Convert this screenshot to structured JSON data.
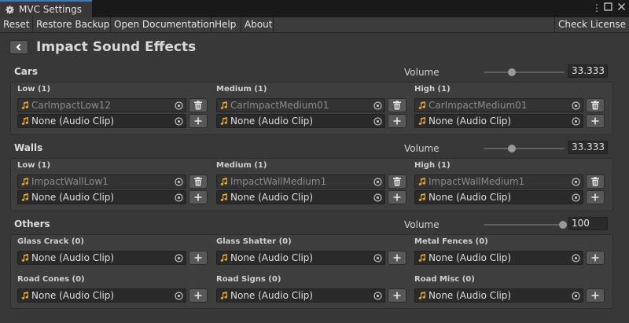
{
  "window": {
    "tab_title": "MVC Settings",
    "icons": [
      "gear-icon",
      "more-vert-icon",
      "maximize-icon",
      "close-icon"
    ]
  },
  "menubar": {
    "reset": "Reset",
    "restore_backup": "Restore Backup",
    "open_documentation": "Open Documentation",
    "help": "Help",
    "about": "About",
    "check_license": "Check License"
  },
  "header": {
    "title": "Impact Sound Effects",
    "back_icon": "chevron-left-icon"
  },
  "colors": {
    "accent": "#3a79bb",
    "note_icon": "#e0a32b",
    "panel": "#3e3e3e"
  },
  "sections": [
    {
      "title": "Cars",
      "volume_label": "Volume",
      "volume": "33.333",
      "volume_fraction": 0.333,
      "groups": [
        {
          "label": "Low (1)",
          "assigned": "CarImpactLow12",
          "empty": "None (Audio Clip)"
        },
        {
          "label": "Medium (1)",
          "assigned": "CarImpactMedium01",
          "empty": "None (Audio Clip)"
        },
        {
          "label": "High (1)",
          "assigned": "CarImpactMedium01",
          "empty": "None (Audio Clip)"
        }
      ]
    },
    {
      "title": "Walls",
      "volume_label": "Volume",
      "volume": "33.333",
      "volume_fraction": 0.333,
      "groups": [
        {
          "label": "Low (1)",
          "assigned": "ImpactWallLow1",
          "empty": "None (Audio Clip)"
        },
        {
          "label": "Medium (1)",
          "assigned": "ImpactWallMedium1",
          "empty": "None (Audio Clip)"
        },
        {
          "label": "High (1)",
          "assigned": "ImpactWallMedium1",
          "empty": "None (Audio Clip)"
        }
      ]
    },
    {
      "title": "Others",
      "volume_label": "Volume",
      "volume": "100",
      "volume_fraction": 1.0,
      "groups": [
        {
          "label": "Glass Crack (0)",
          "empty": "None (Audio Clip)"
        },
        {
          "label": "Glass Shatter (0)",
          "empty": "None (Audio Clip)"
        },
        {
          "label": "Metal Fences (0)",
          "empty": "None (Audio Clip)"
        },
        {
          "label": "Road Cones (0)",
          "empty": "None (Audio Clip)"
        },
        {
          "label": "Road Signs (0)",
          "empty": "None (Audio Clip)"
        },
        {
          "label": "Road Misc (0)",
          "empty": "None (Audio Clip)"
        }
      ]
    }
  ]
}
